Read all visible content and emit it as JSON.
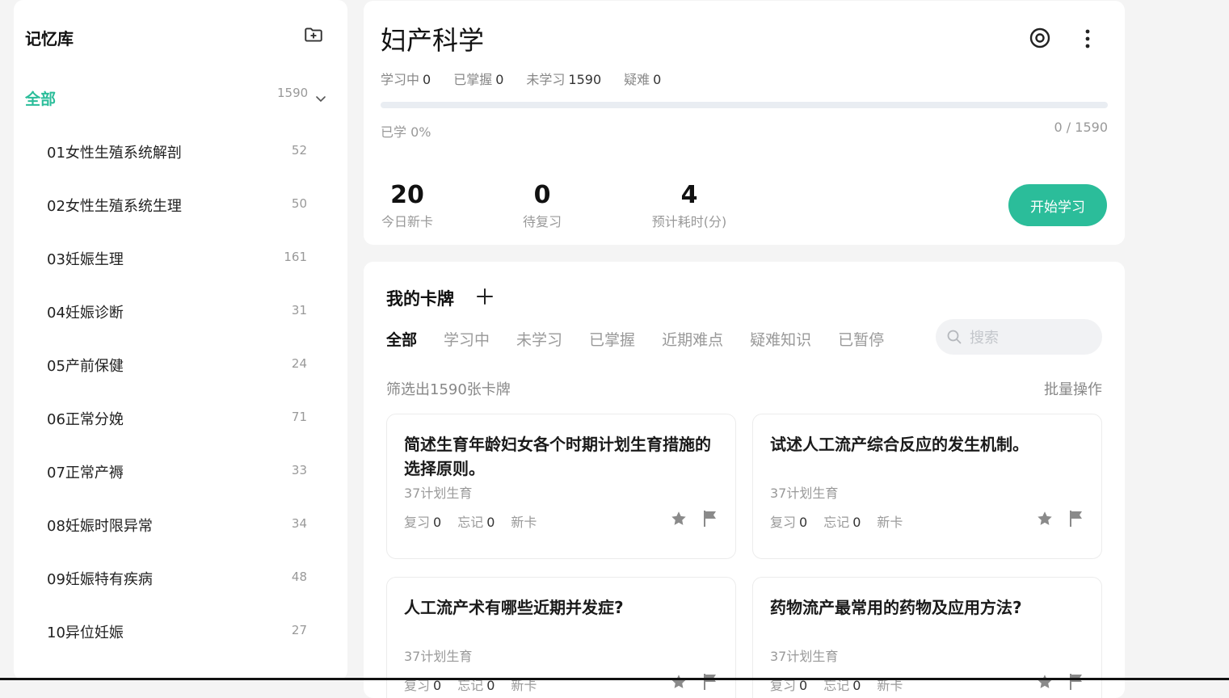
{
  "sidebar": {
    "title": "记忆库",
    "all": {
      "label": "全部",
      "count": "1590"
    },
    "items": [
      {
        "label": "01女性生殖系统解剖",
        "count": "52"
      },
      {
        "label": "02女性生殖系统生理",
        "count": "50"
      },
      {
        "label": "03妊娠生理",
        "count": "161"
      },
      {
        "label": "04妊娠诊断",
        "count": "31"
      },
      {
        "label": "05产前保健",
        "count": "24"
      },
      {
        "label": "06正常分娩",
        "count": "71"
      },
      {
        "label": "07正常产褥",
        "count": "33"
      },
      {
        "label": "08妊娠时限异常",
        "count": "34"
      },
      {
        "label": "09妊娠特有疾病",
        "count": "48"
      },
      {
        "label": "10异位妊娠",
        "count": "27"
      }
    ]
  },
  "deck": {
    "title": "妇产科学",
    "stats": [
      {
        "label": "学习中",
        "value": "0"
      },
      {
        "label": "已掌握",
        "value": "0"
      },
      {
        "label": "未学习",
        "value": "1590"
      },
      {
        "label": "疑难",
        "value": "0"
      }
    ],
    "progress_percent": 0,
    "learned_label": "已学 0%",
    "ratio": "0 / 1590",
    "metrics": [
      {
        "value": "20",
        "label": "今日新卡"
      },
      {
        "value": "0",
        "label": "待复习"
      },
      {
        "value": "4",
        "label": "预计耗时(分)"
      }
    ],
    "start_button": "开始学习"
  },
  "cards_panel": {
    "title": "我的卡牌",
    "tabs": [
      "全部",
      "学习中",
      "未学习",
      "已掌握",
      "近期难点",
      "疑难知识",
      "已暂停"
    ],
    "active_tab": 0,
    "search_placeholder": "搜索",
    "filter_info": "筛选出1590张卡牌",
    "batch_action": "批量操作",
    "cards": [
      {
        "question": "简述生育年龄妇女各个时期计划生育措施的选择原则。",
        "category": "37计划生育",
        "review_label": "复习",
        "review": "0",
        "forget_label": "忘记",
        "forget": "0",
        "status": "新卡"
      },
      {
        "question": "试述人工流产综合反应的发生机制。",
        "category": "37计划生育",
        "review_label": "复习",
        "review": "0",
        "forget_label": "忘记",
        "forget": "0",
        "status": "新卡"
      },
      {
        "question": "人工流产术有哪些近期并发症?",
        "category": "37计划生育",
        "review_label": "复习",
        "review": "0",
        "forget_label": "忘记",
        "forget": "0",
        "status": "新卡"
      },
      {
        "question": "药物流产最常用的药物及应用方法?",
        "category": "37计划生育",
        "review_label": "复习",
        "review": "0",
        "forget_label": "忘记",
        "forget": "0",
        "status": "新卡"
      }
    ]
  },
  "icons": {
    "add_folder": "folder-plus-icon",
    "chevron": "chevron-down-icon",
    "settings": "target-settings-icon",
    "more": "more-vertical-icon",
    "add": "plus-icon",
    "search": "search-icon",
    "star": "star-icon",
    "flag": "flag-icon"
  },
  "colors": {
    "accent": "#2bbd9a",
    "text": "#222222",
    "muted": "#999999",
    "background": "#f4f4f4"
  }
}
